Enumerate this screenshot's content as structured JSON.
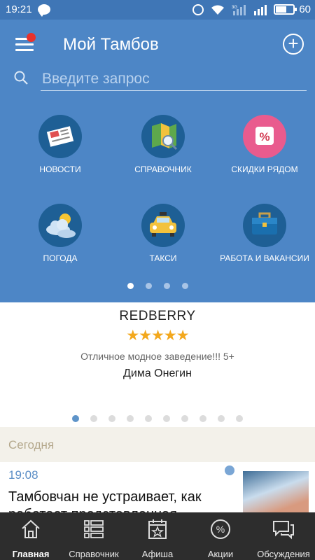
{
  "status_bar": {
    "time": "19:21",
    "battery": "60",
    "network": "3G"
  },
  "app": {
    "title": "Мой Тамбов"
  },
  "search": {
    "placeholder": "Введите запрос"
  },
  "tiles": [
    {
      "label": "НОВОСТИ",
      "icon": "newspaper-icon",
      "color": "#1e5f95"
    },
    {
      "label": "СПРАВОЧНИК",
      "icon": "map-icon",
      "color": "#1e5f95"
    },
    {
      "label": "СКИДКИ РЯДОМ",
      "icon": "percent-icon",
      "color": "#e95b8e"
    },
    {
      "label": "ПОГОДА",
      "icon": "weather-icon",
      "color": "#1e5f95"
    },
    {
      "label": "ТАКСИ",
      "icon": "taxi-icon",
      "color": "#1e5f95"
    },
    {
      "label": "РАБОТА И ВАКАНСИИ",
      "icon": "briefcase-icon",
      "color": "#1e5f95"
    }
  ],
  "review": {
    "name": "REDBERRY",
    "stars": "★★★★★",
    "rating": 5,
    "text": "Отличное модное заведение!!! 5+",
    "author": "Дима  Онегин"
  },
  "section": {
    "label": "Сегодня"
  },
  "news": {
    "time": "19:08",
    "title": "Тамбовчан не устраивает, как работает представленная оферта"
  },
  "tabs": [
    {
      "label": "Главная",
      "icon": "home-icon"
    },
    {
      "label": "Справочник",
      "icon": "list-icon"
    },
    {
      "label": "Афиша",
      "icon": "calendar-star-icon"
    },
    {
      "label": "Акции",
      "icon": "percent-circle-icon"
    },
    {
      "label": "Обсуждения",
      "icon": "chat-icon"
    }
  ],
  "colors": {
    "primary": "#4d86c6",
    "accent": "#e8322c",
    "stars": "#f3a81d",
    "tabbar": "#2d2d2d"
  }
}
